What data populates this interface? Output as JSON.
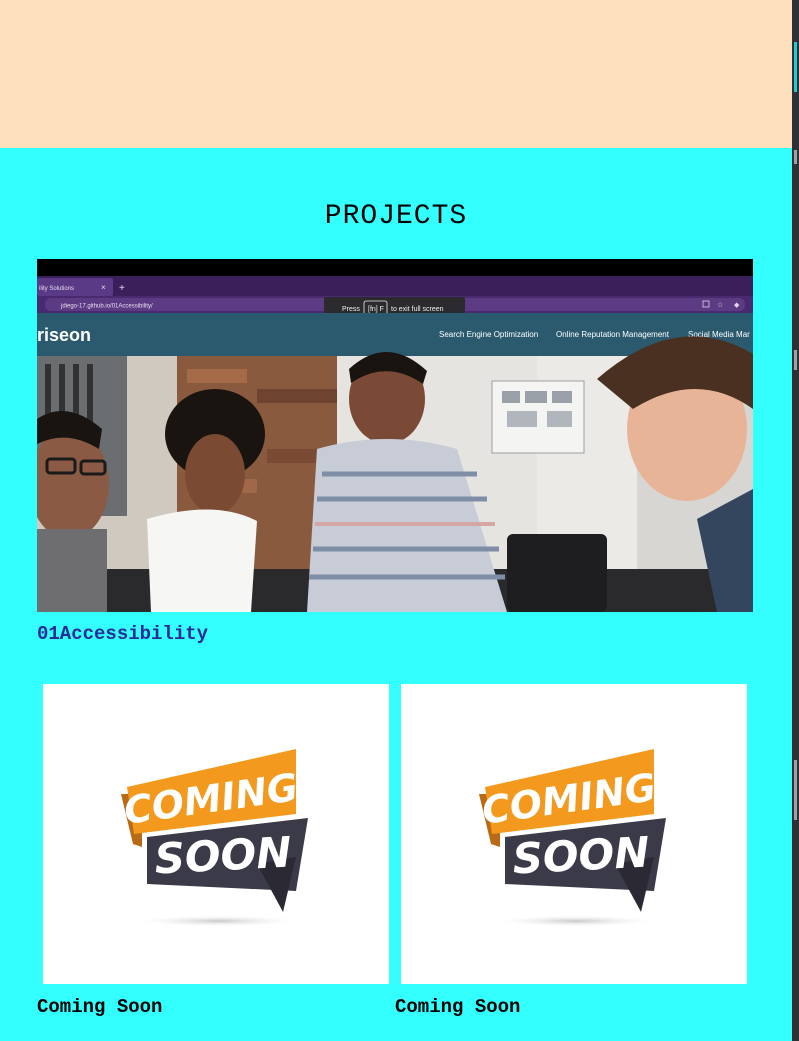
{
  "section": {
    "title": "PROJECTS"
  },
  "featured": {
    "title": "01Accessibility",
    "screenshot": {
      "tab_title": "ility Solutions",
      "tab_close": "×",
      "new_tab": "+",
      "url": "jdiego-17.github.io/01Accessibility/",
      "fullscreen_prefix": "Press",
      "fullscreen_key": "[fn] F",
      "fullscreen_suffix": "to exit full screen",
      "site_logo": "riseon",
      "site_nav": [
        "Search Engine Optimization",
        "Online Reputation Management",
        "Social Media Mar"
      ]
    }
  },
  "cards": [
    {
      "caption": "Coming Soon",
      "badge_top": "COMING",
      "badge_bottom": "SOON"
    },
    {
      "caption": "Coming Soon",
      "badge_top": "COMING",
      "badge_bottom": "SOON"
    }
  ],
  "colors": {
    "page_bg": "#33ffff",
    "top_band": "#ffe0bd",
    "link": "#2a2a9a",
    "badge_orange": "#f39a1e",
    "badge_dark": "#3b3a48"
  }
}
